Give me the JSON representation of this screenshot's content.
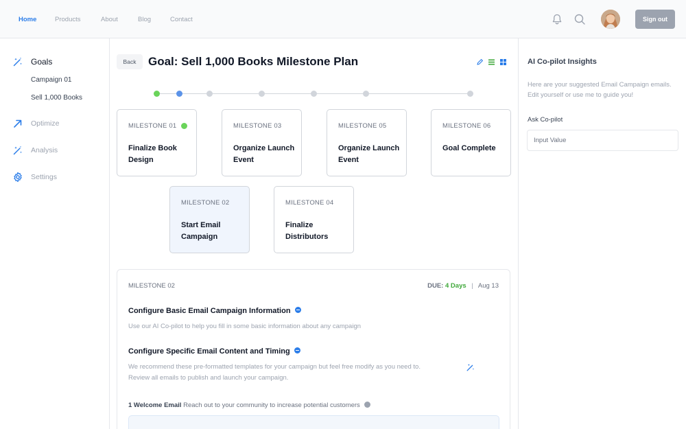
{
  "nav": {
    "links": [
      "Home",
      "Products",
      "About",
      "Blog",
      "Contact"
    ],
    "active": "Home",
    "signout_label": "Sign out",
    "icons": [
      "bell-icon",
      "search-icon"
    ]
  },
  "sidebar": {
    "items": [
      {
        "label": "Goals",
        "icon": "magic-wand-icon",
        "active": true
      },
      {
        "label": "Optimize",
        "icon": "arrow-up-left-icon"
      },
      {
        "label": "Analysis",
        "icon": "magic-wand-icon"
      },
      {
        "label": "Settings",
        "icon": "gear-icon"
      }
    ],
    "subitems": [
      "Campaign 01",
      "Sell 1,000 Books"
    ]
  },
  "header": {
    "back_label": "Back",
    "title": "Goal: Sell 1,000 Books Milestone Plan",
    "view_icons": [
      "pencil-icon",
      "list-icon",
      "grid-icon"
    ]
  },
  "milestones": [
    {
      "label": "MILESTONE 01",
      "title": "Finalize Book Design",
      "complete": true
    },
    {
      "label": "MILESTONE 03",
      "title": "Organize Launch Event"
    },
    {
      "label": "MILESTONE 05",
      "title": "Organize Launch Event"
    },
    {
      "label": "MILESTONE 06",
      "title": "Goal Complete"
    },
    {
      "label": "MILESTONE 02",
      "title": "Start Email Campaign",
      "selected": true
    },
    {
      "label": "MILESTONE 04",
      "title": "Finalize Distributors"
    }
  ],
  "detail": {
    "label": "MILESTONE 02",
    "due_prefix": "DUE:",
    "due_days": "4 Days",
    "due_date": "Aug 13",
    "section1_title": "Configure Basic Email Campaign Information",
    "section1_text": "Use our AI Co-pilot to help you fill in some basic information about any campaign",
    "section2_title": "Configure Specific Email Content and Timing",
    "section2_text1": "We recommend these pre-formatted templates for your campaign but feel free modify as you need to.",
    "section2_text2": "Review all emails to publish and launch your campaign.",
    "welcome_title": "1 Welcome Email",
    "welcome_text": "Reach out to your community to increase potential customers"
  },
  "copilot": {
    "title": "AI Co-pilot Insights",
    "text": "Here are your suggested Email Campaign emails. Edit yourself or use me to guide you!",
    "ask_label": "Ask Co-pilot",
    "input_placeholder": "Input Value"
  },
  "colors": {
    "accent": "#2b7de9",
    "success": "#6ad45a",
    "muted": "#9ca3af"
  }
}
